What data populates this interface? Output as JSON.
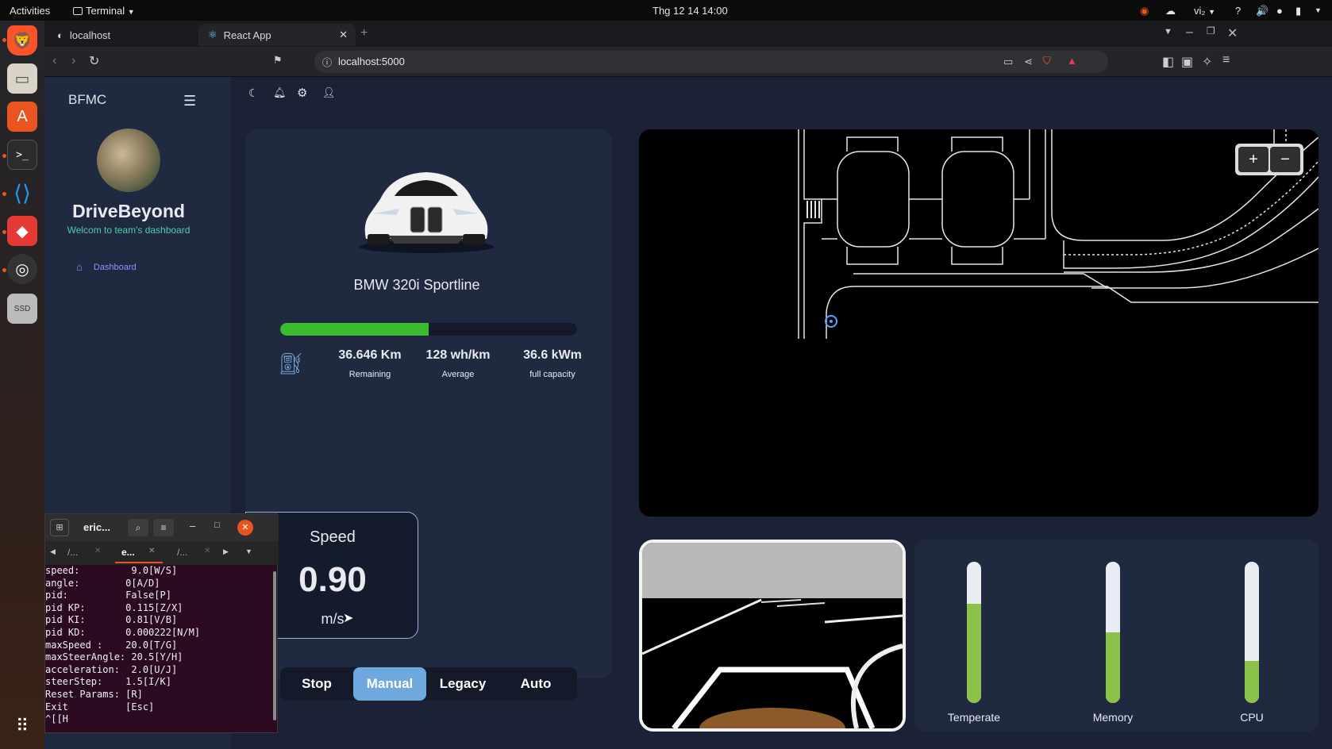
{
  "gnome_bar": {
    "activities": "Activities",
    "terminal_menu": "Terminal",
    "clock": "Thg 12 14  14:00",
    "input_method": "vi₂"
  },
  "browser": {
    "tabs": [
      {
        "label": "localhost"
      },
      {
        "label": "React App"
      }
    ],
    "url": "localhost:5000"
  },
  "sidebar": {
    "brand": "BFMC",
    "team_name": "DriveBeyond",
    "welcome": "Welcom to team's dashboard",
    "nav": [
      {
        "label": "Dashboard",
        "icon": "home-icon"
      }
    ]
  },
  "header_icons": [
    "moon-icon",
    "bell-icon",
    "gear-icon",
    "user-icon"
  ],
  "car": {
    "model": "BMW 320i Sportline",
    "battery_level": 0.5,
    "stats": [
      {
        "value": "36.646 Km",
        "label": "Remaining"
      },
      {
        "value": "128 wh/km",
        "label": "Average"
      },
      {
        "value": "36.6 kWm",
        "label": "full capacity"
      }
    ]
  },
  "speed": {
    "title": "Speed",
    "value": "0.90",
    "unit": "m/s"
  },
  "modes": {
    "options": [
      "Stop",
      "Manual",
      "Legacy",
      "Auto"
    ],
    "selected": "Manual"
  },
  "map": {
    "zoom_in": "+",
    "zoom_out": "−"
  },
  "resources": [
    {
      "label": "Temperate",
      "level": 0.7
    },
    {
      "label": "Memory",
      "level": 0.5
    },
    {
      "label": "CPU",
      "level": 0.3
    }
  ],
  "terminal": {
    "title": "eric...",
    "tabs": [
      "/...",
      "e...",
      "/..."
    ],
    "lines": [
      "speed:         9.0[W/S]",
      "angle:        0[A/D]",
      "pid:          False[P]",
      "pid KP:       0.115[Z/X]",
      "pid KI:       0.81[V/B]",
      "pid KD:       0.000222[N/M]",
      "maxSpeed :    20.0[T/G]",
      "maxSteerAngle: 20.5[Y/H]",
      "acceleration:  2.0[U/J]",
      "steerStep:    1.5[I/K]",
      "Reset Params: [R]",
      "Exit          [Esc]",
      "^[[H"
    ]
  },
  "colors": {
    "accent": "#7aa7d4",
    "battery": "#3cbc2d",
    "gauge": "#8bc34a",
    "panel": "#1f2940"
  }
}
